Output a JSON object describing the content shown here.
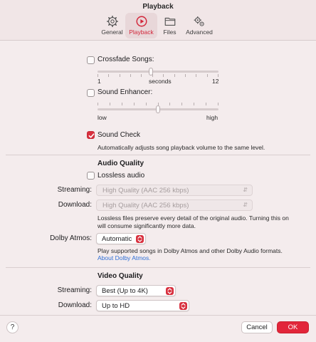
{
  "window": {
    "title": "Playback"
  },
  "toolbar": {
    "tabs": [
      {
        "label": "General",
        "icon": "gear-icon"
      },
      {
        "label": "Playback",
        "icon": "play-circle-icon"
      },
      {
        "label": "Files",
        "icon": "folder-icon"
      },
      {
        "label": "Advanced",
        "icon": "gears-icon"
      }
    ],
    "active_tab": "Playback"
  },
  "crossfade": {
    "label": "Crossfade Songs:",
    "checked": false,
    "min_label": "1",
    "unit_label": "seconds",
    "max_label": "12",
    "value_fraction": 0.44
  },
  "sound_enhancer": {
    "label": "Sound Enhancer:",
    "checked": false,
    "low_label": "low",
    "high_label": "high",
    "value_fraction": 0.5
  },
  "sound_check": {
    "label": "Sound Check",
    "checked": true,
    "description": "Automatically adjusts song playback volume to the same level."
  },
  "audio_quality": {
    "heading": "Audio Quality",
    "lossless_label": "Lossless audio",
    "lossless_checked": false,
    "streaming_label": "Streaming:",
    "streaming_value": "High Quality (AAC 256 kbps)",
    "download_label": "Download:",
    "download_value": "High Quality (AAC 256 kbps)",
    "description_line1": "Lossless files preserve every detail of the original audio. Turning this on",
    "description_line2": "will consume significantly more data.",
    "dolby_label": "Dolby Atmos:",
    "dolby_value": "Automatic",
    "dolby_description": "Play supported songs in Dolby Atmos and other Dolby Audio formats.",
    "dolby_link": "About Dolby Atmos."
  },
  "video_quality": {
    "heading": "Video Quality",
    "streaming_label": "Streaming:",
    "streaming_value": "Best (Up to 4K)",
    "download_label": "Download:",
    "download_value": "Up to HD"
  },
  "footer": {
    "help_label": "?",
    "cancel_label": "Cancel",
    "ok_label": "OK"
  },
  "colors": {
    "accent": "#d8303e",
    "link": "#2f6fd6",
    "background": "#f4eced"
  }
}
